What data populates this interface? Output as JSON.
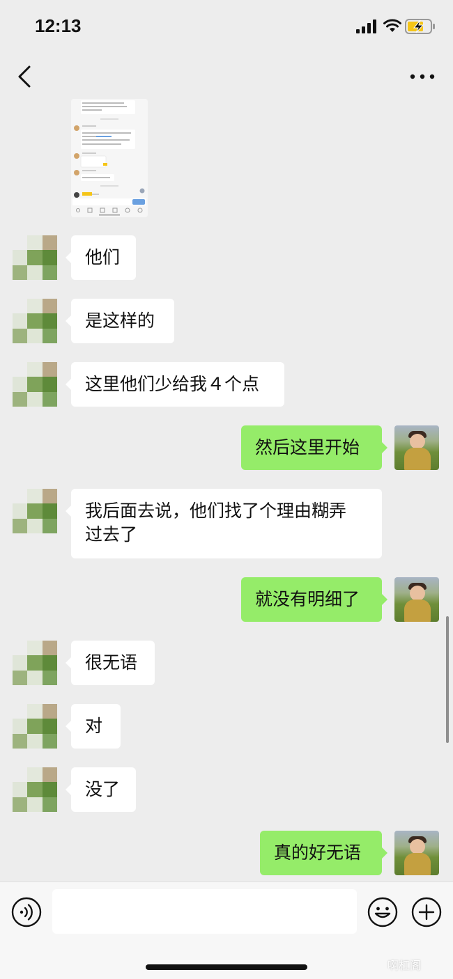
{
  "status_bar": {
    "time": "12:13"
  },
  "nav": {
    "back_icon": "chevron-left-icon",
    "more_icon": "more-dots-icon"
  },
  "colors": {
    "background": "#ededed",
    "incoming_bubble": "#ffffff",
    "outgoing_bubble": "#95ec69"
  },
  "messages": [
    {
      "side": "left",
      "text": "他们"
    },
    {
      "side": "left",
      "text": "是这样的"
    },
    {
      "side": "left",
      "text": "这里他们少给我４个点"
    },
    {
      "side": "right",
      "text": "然后这里开始"
    },
    {
      "side": "left",
      "text": "我后面去说，他们找了个理由糊弄\n过去了"
    },
    {
      "side": "right",
      "text": "就没有明细了"
    },
    {
      "side": "left",
      "text": "很无语"
    },
    {
      "side": "left",
      "text": "对"
    },
    {
      "side": "left",
      "text": "没了"
    },
    {
      "side": "right",
      "text": "真的好无语"
    }
  ],
  "input_bar": {
    "input_value": "",
    "voice_icon": "voice-icon",
    "emoji_icon": "emoji-icon",
    "plus_icon": "plus-icon"
  },
  "watermark": "啊杠阁"
}
